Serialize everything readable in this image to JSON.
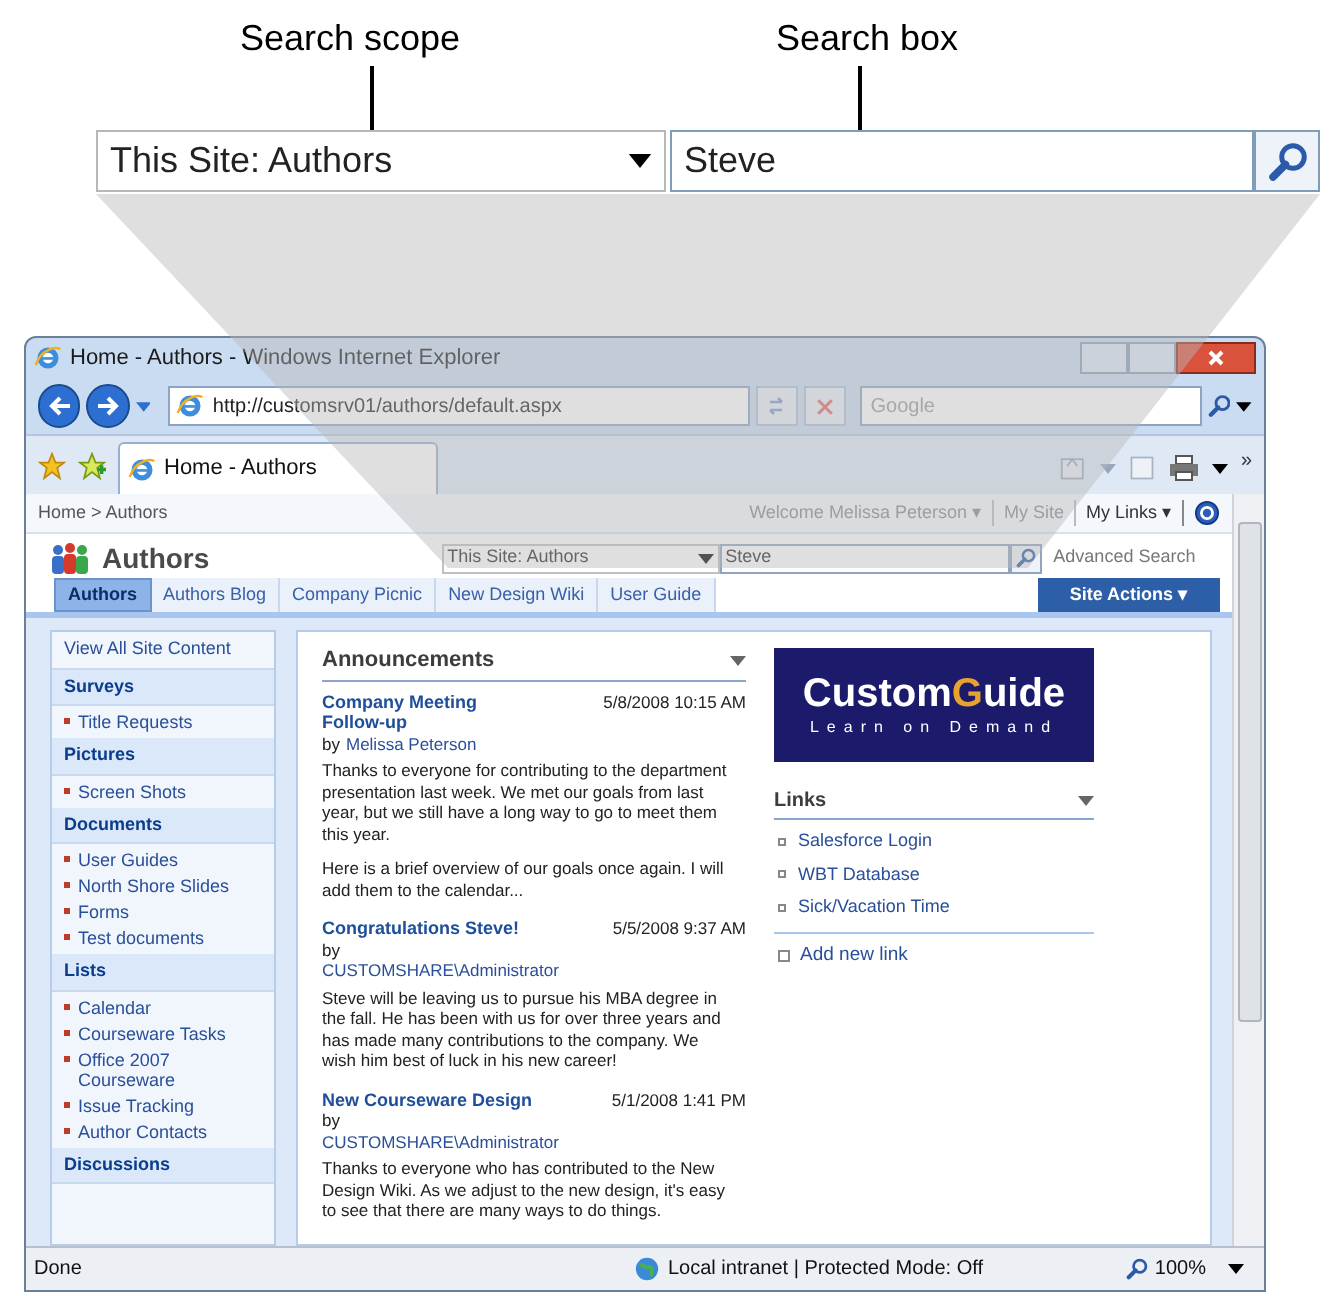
{
  "callout": {
    "scope_label": "Search scope",
    "box_label": "Search box",
    "scope_value": "This Site: Authors",
    "box_value": "Steve"
  },
  "window": {
    "title": "Home - Authors - Windows Internet Explorer"
  },
  "address_bar": {
    "url": "http://customsrv01/authors/default.aspx",
    "search_placeholder": "Google"
  },
  "tab": {
    "label": "Home - Authors",
    "more": "»"
  },
  "page": {
    "breadcrumb": "Home > Authors",
    "welcome": "Welcome Melissa Peterson ▾",
    "my_site": "My Site",
    "my_links": "My Links ▾",
    "site_title": "Authors",
    "scope": "This Site: Authors",
    "search_value": "Steve",
    "advanced_search": "Advanced Search",
    "site_actions": "Site Actions ▾"
  },
  "nav_tabs": [
    {
      "label": "Authors",
      "selected": true
    },
    {
      "label": "Authors Blog",
      "selected": false
    },
    {
      "label": "Company Picnic",
      "selected": false
    },
    {
      "label": "New Design Wiki",
      "selected": false
    },
    {
      "label": "User Guide",
      "selected": false
    }
  ],
  "quick_launch": {
    "view_all": "View All Site Content",
    "sections": [
      {
        "heading": "Surveys",
        "items": [
          "Title Requests"
        ]
      },
      {
        "heading": "Pictures",
        "items": [
          "Screen Shots"
        ]
      },
      {
        "heading": "Documents",
        "items": [
          "User Guides",
          "North Shore Slides",
          "Forms",
          "Test documents"
        ]
      },
      {
        "heading": "Lists",
        "items": [
          "Calendar",
          "Courseware Tasks",
          "Office 2007 Courseware",
          "Issue Tracking",
          "Author Contacts"
        ]
      },
      {
        "heading": "Discussions"
      }
    ]
  },
  "announcements": {
    "title": "Announcements",
    "items": [
      {
        "title": "Company Meeting Follow-up",
        "date": "5/8/2008 10:15 AM",
        "by": "by",
        "author": "Melissa Peterson",
        "kind": "inline",
        "paragraphs": [
          "Thanks to everyone for contributing to the department presentation last week. We met our goals from last year, but we still have a long way to go to meet them this year.",
          "Here is a brief overview of our goals once again. I will add them to the calendar..."
        ]
      },
      {
        "title": "Congratulations Steve!",
        "date": "5/5/2008 9:37 AM",
        "by": "by",
        "author": "CUSTOMSHARE\\Administrator",
        "kind": "stacked",
        "paragraphs": [
          "Steve will be leaving us to pursue his MBA degree in the fall. He has been with us for over three years and has made many contributions to the company. We wish him best of luck in his new career!"
        ]
      },
      {
        "title": "New Courseware Design",
        "date": "5/1/2008 1:41 PM",
        "by": "by",
        "author": "CUSTOMSHARE\\Administrator",
        "kind": "stacked",
        "paragraphs": [
          "Thanks to everyone who has contributed to the New Design Wiki. As we adjust to the new design, it's easy to see that there are many ways to do things."
        ]
      }
    ]
  },
  "logo": {
    "word_start": "Custom",
    "accent": "G",
    "word_end": "uide",
    "tagline": "Learn on Demand"
  },
  "links": {
    "title": "Links",
    "items": [
      "Salesforce Login",
      "WBT Database",
      "Sick/Vacation Time"
    ],
    "add": "Add new link"
  },
  "status_bar": {
    "text": "Done",
    "zone": "Local intranet | Protected Mode: Off",
    "zoom": "100%"
  }
}
